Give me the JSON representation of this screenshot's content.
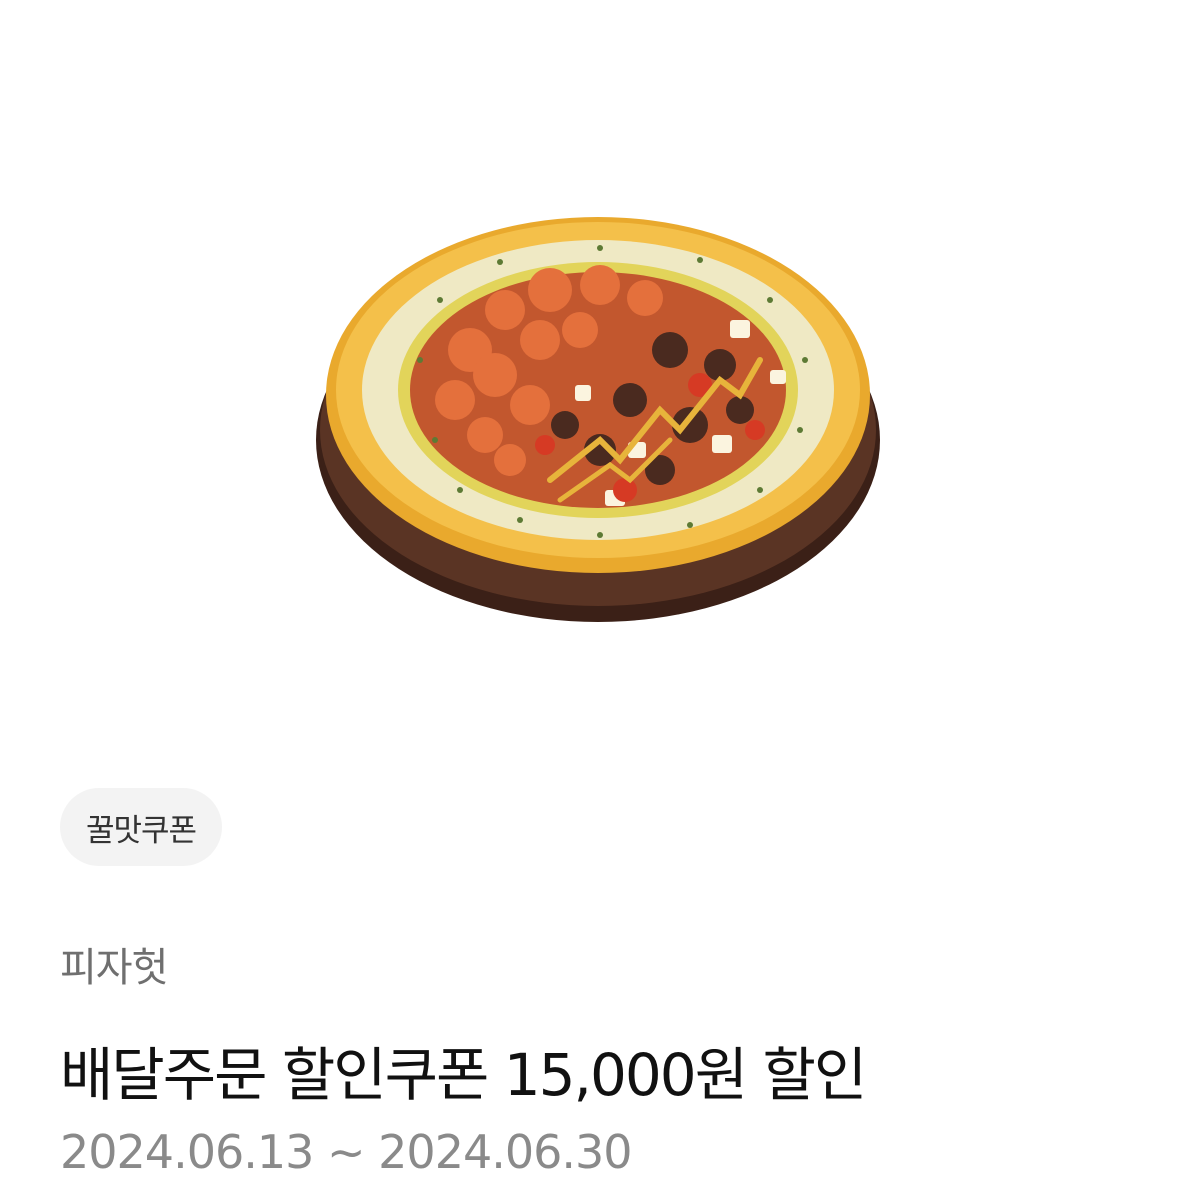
{
  "product_image": {
    "icon": "pizza-image"
  },
  "coupon": {
    "badge_label": "꿀맛쿠폰",
    "brand": "피자헛",
    "title": "배달주문 할인쿠폰 15,000원 할인",
    "period": "2024.06.13 ~ 2024.06.30"
  }
}
